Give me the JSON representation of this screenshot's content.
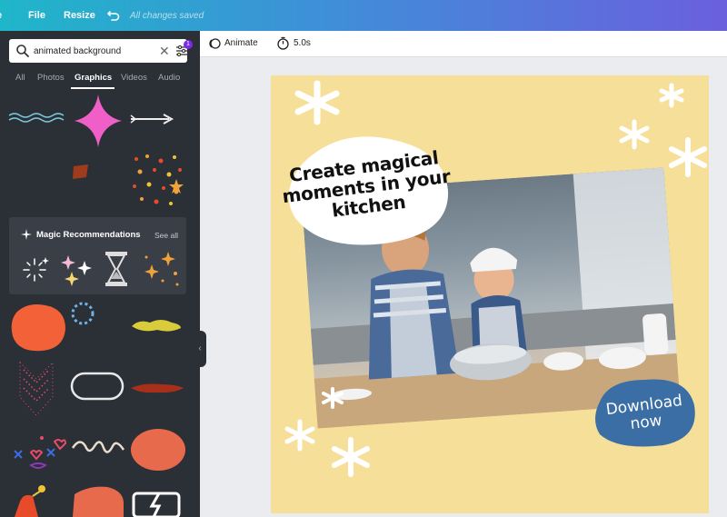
{
  "topbar": {
    "home_label": "e",
    "file_label": "File",
    "resize_label": "Resize",
    "saved_status": "All changes saved"
  },
  "search": {
    "value": "animated background",
    "filter_badge_count": "1"
  },
  "tabs": [
    {
      "label": "All",
      "active": false
    },
    {
      "label": "Photos",
      "active": false
    },
    {
      "label": "Graphics",
      "active": true
    },
    {
      "label": "Videos",
      "active": false
    },
    {
      "label": "Audio",
      "active": false
    }
  ],
  "magic": {
    "title": "Magic Recommendations",
    "see_all": "See all"
  },
  "toolbar": {
    "animate_label": "Animate",
    "duration_label": "5.0s"
  },
  "canvas": {
    "headline": "Create magical moments in your kitchen",
    "cta": "Download now",
    "colors": {
      "background": "#f6e099",
      "cta_blob": "#3a6ea5",
      "headline_blob": "#ffffff",
      "accent_pink": "#f05fc8",
      "accent_orange": "#f26138"
    }
  },
  "icons": [
    "undo-icon",
    "search-icon",
    "clear-icon",
    "filter-icon",
    "sparkle-icon",
    "animate-icon",
    "timer-icon",
    "collapse-chevron-icon"
  ]
}
